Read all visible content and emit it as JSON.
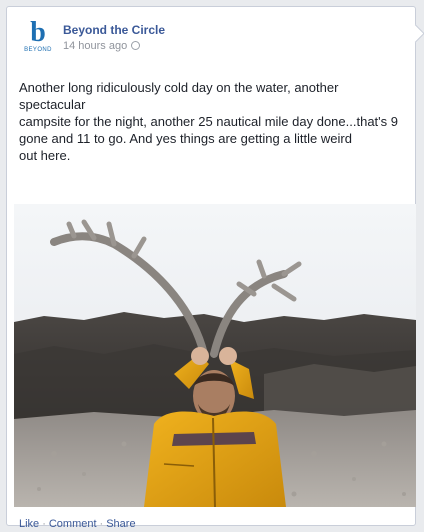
{
  "post": {
    "page_name": "Beyond the Circle",
    "timestamp": "14 hours ago",
    "privacy_icon": "globe-icon",
    "avatar": {
      "letter": "b",
      "caption": "BEYOND"
    },
    "text_lines": [
      "Another long ridiculously cold day on the water, another",
      "spectacular",
      "campsite for the night, another 25 nautical mile day done...that's 9",
      "gone and 11 to go. And yes things are getting a little weird",
      "out here."
    ]
  },
  "actions": {
    "like": "Like",
    "comment": "Comment",
    "share": "Share",
    "separator": "·"
  },
  "colors": {
    "link": "#3b5998",
    "meta": "#90949c",
    "brand": "#1e6fb2"
  }
}
